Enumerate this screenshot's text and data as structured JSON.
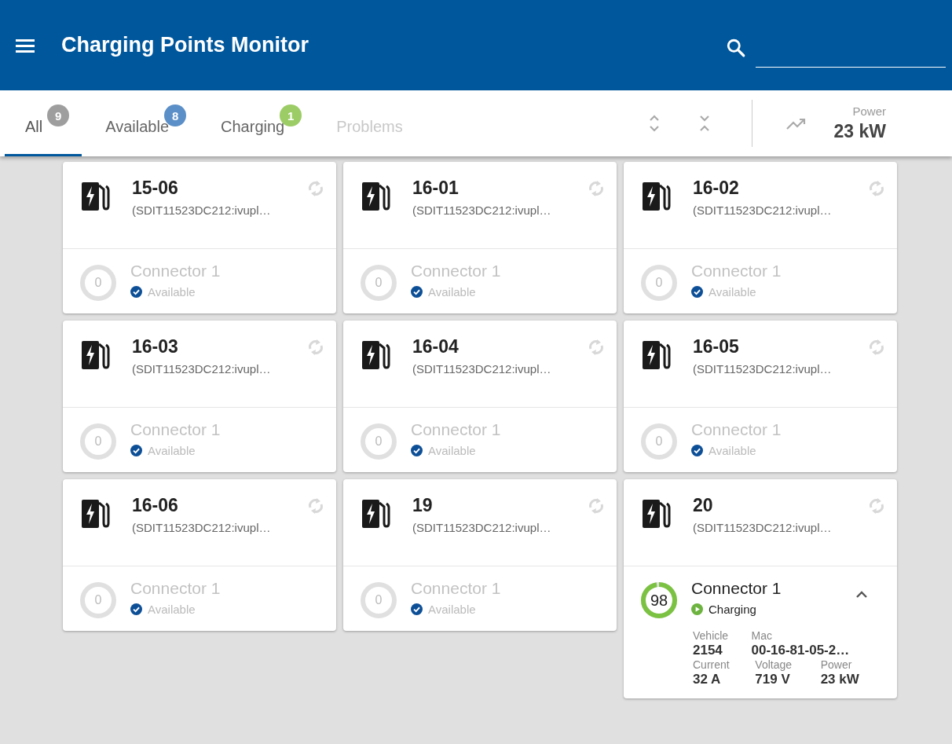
{
  "app_bar": {
    "title": "Charging Points Monitor"
  },
  "tabs": [
    {
      "label": "All",
      "count": "9",
      "color": "#9e9e9e",
      "selected": true,
      "disabled": false
    },
    {
      "label": "Available",
      "count": "8",
      "color": "#5b8fc7",
      "selected": false,
      "disabled": false
    },
    {
      "label": "Charging",
      "count": "1",
      "color": "#9ccc65",
      "selected": false,
      "disabled": false
    },
    {
      "label": "Problems",
      "selected": false,
      "disabled": true
    }
  ],
  "summary": {
    "label": "Power",
    "value": "23 kW"
  },
  "charging_points": [
    {
      "name": "15-06",
      "id": "(SDIT11523DC212:ivupl…",
      "connectors": [
        {
          "name": "Connector 1",
          "kind": "available",
          "status_label": "Available",
          "reading": "0",
          "expanded": false
        }
      ]
    },
    {
      "name": "16-01",
      "id": "(SDIT11523DC212:ivupl…",
      "connectors": [
        {
          "name": "Connector 1",
          "kind": "available",
          "status_label": "Available",
          "reading": "0",
          "expanded": false
        }
      ]
    },
    {
      "name": "16-02",
      "id": "(SDIT11523DC212:ivupl…",
      "connectors": [
        {
          "name": "Connector 1",
          "kind": "available",
          "status_label": "Available",
          "reading": "0",
          "expanded": false
        }
      ]
    },
    {
      "name": "16-03",
      "id": "(SDIT11523DC212:ivupl…",
      "connectors": [
        {
          "name": "Connector 1",
          "kind": "available",
          "status_label": "Available",
          "reading": "0",
          "expanded": false
        }
      ]
    },
    {
      "name": "16-04",
      "id": "(SDIT11523DC212:ivupl…",
      "connectors": [
        {
          "name": "Connector 1",
          "kind": "available",
          "status_label": "Available",
          "reading": "0",
          "expanded": false
        }
      ]
    },
    {
      "name": "16-05",
      "id": "(SDIT11523DC212:ivupl…",
      "connectors": [
        {
          "name": "Connector 1",
          "kind": "available",
          "status_label": "Available",
          "reading": "0",
          "expanded": false
        }
      ]
    },
    {
      "name": "16-06",
      "id": "(SDIT11523DC212:ivupl…",
      "connectors": [
        {
          "name": "Connector 1",
          "kind": "available",
          "status_label": "Available",
          "reading": "0",
          "expanded": false
        }
      ]
    },
    {
      "name": "19",
      "id": "(SDIT11523DC212:ivupl…",
      "connectors": [
        {
          "name": "Connector 1",
          "kind": "available",
          "status_label": "Available",
          "reading": "0",
          "expanded": false
        }
      ]
    },
    {
      "name": "20",
      "id": "(SDIT11523DC212:ivupl…",
      "connectors": [
        {
          "name": "Connector 1",
          "kind": "charging",
          "status_label": "Charging",
          "reading": "98",
          "expanded": true,
          "details": [
            [
              {
                "label": "Vehicle",
                "value": "2154"
              },
              {
                "label": "Mac",
                "value": "00-16-81-05-2…"
              }
            ],
            [
              {
                "label": "Current",
                "value": "32 A"
              },
              {
                "label": "Voltage",
                "value": "719 V"
              },
              {
                "label": "Power",
                "value": "23 kW"
              }
            ]
          ]
        }
      ]
    }
  ]
}
